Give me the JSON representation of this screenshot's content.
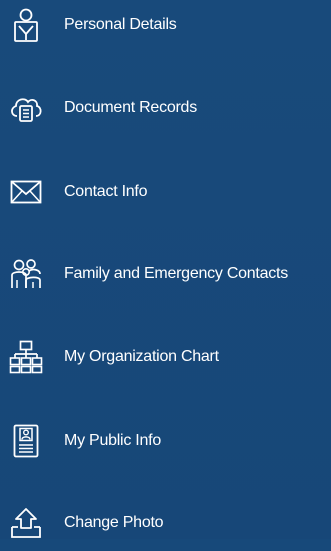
{
  "menu": {
    "items": [
      {
        "label": "Personal Details",
        "icon": "person-badge-icon"
      },
      {
        "label": "Document Records",
        "icon": "cloud-document-icon"
      },
      {
        "label": "Contact Info",
        "icon": "envelope-icon"
      },
      {
        "label": "Family and Emergency Contacts",
        "icon": "family-icon"
      },
      {
        "label": "My Organization Chart",
        "icon": "organization-chart-icon"
      },
      {
        "label": "My Public Info",
        "icon": "id-card-icon"
      },
      {
        "label": "Change Photo",
        "icon": "upload-photo-icon"
      }
    ]
  },
  "colors": {
    "background": "#184a7b",
    "text": "#ffffff",
    "icon_stroke": "#ffffff"
  }
}
